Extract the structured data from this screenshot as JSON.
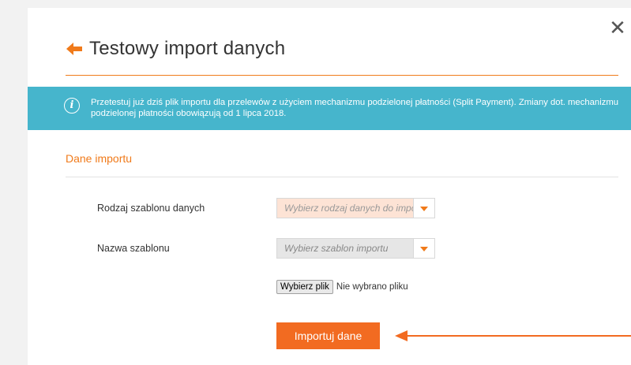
{
  "modal": {
    "title": "Testowy import danych",
    "close_glyph": "✕"
  },
  "info": {
    "icon_glyph": "i",
    "text": "Przetestuj już dziś plik importu dla przelewów z użyciem mechanizmu podzielonej płatności (Split Payment). Zmiany dot. mechanizmu podzielonej płatności obowiązują od 1 lipca 2018."
  },
  "section": {
    "title": "Dane importu"
  },
  "form": {
    "data_type_label": "Rodzaj szablonu danych",
    "data_type_placeholder": "Wybierz rodzaj danych do importu",
    "template_label": "Nazwa szablonu",
    "template_placeholder": "Wybierz szablon importu",
    "file_button_label": "Wybierz plik",
    "file_status": "Nie wybrano pliku",
    "import_button_label": "Importuj dane"
  },
  "colors": {
    "accent": "#f26b21",
    "info_banner": "#46b5cc",
    "highlight_select": "#fde3d5"
  },
  "icons": {
    "back": "back-arrow-icon",
    "close": "close-icon",
    "info": "info-icon",
    "dropdown": "chevron-down-icon",
    "annotation": "pointer-arrow-icon"
  }
}
